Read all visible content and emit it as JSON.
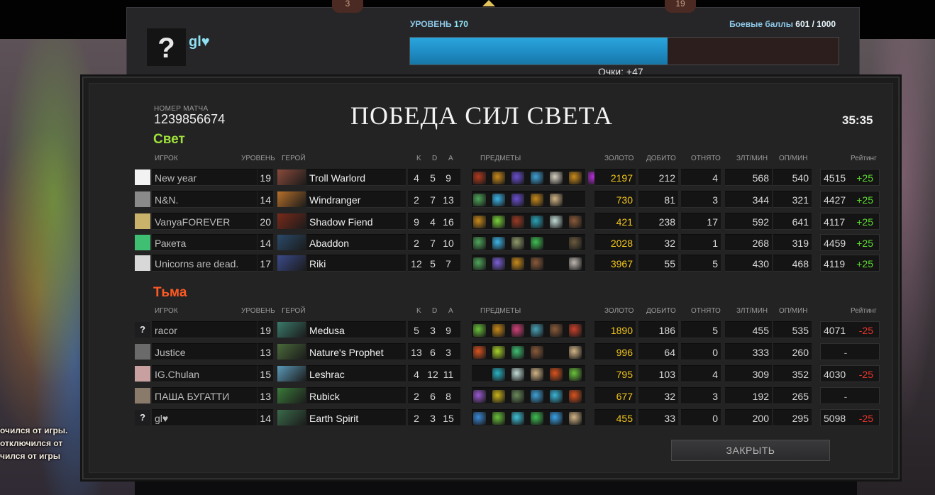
{
  "top_panel": {
    "badge_left": "3",
    "badge_right": "19",
    "avatar_glyph": "?",
    "player_name": "gl♥",
    "level_label": "УРОВЕНЬ",
    "level_value": "170",
    "battle_points_label": "Боевые баллы",
    "battle_points_value": "601 / 1000",
    "battle_points_fraction": 0.601,
    "points_gained": "Очки: +47"
  },
  "side_messages": [
    "очился от игры.",
    "отключился от",
    "чился от игры"
  ],
  "match": {
    "number_label": "НОМЕР МАТЧА",
    "number": "1239856674",
    "result_title": "ПОБЕДА СИЛ СВЕТА",
    "duration": "35:35"
  },
  "headers": {
    "player": "ИГРОК",
    "level": "УРОВЕНЬ",
    "hero": "ГЕРОЙ",
    "k": "K",
    "d": "D",
    "a": "A",
    "items": "ПРЕДМЕТЫ",
    "gold": "ЗОЛОТО",
    "last_hits": "ДОБИТО",
    "denies": "ОТНЯТО",
    "gpm": "ЗЛТ/МИН",
    "xpm": "ОП/МИН",
    "rating": "Рейтинг"
  },
  "teams": [
    {
      "name": "Свет",
      "players": [
        {
          "icon": "",
          "name": "New year",
          "level": "19",
          "hero": "Troll Warlord",
          "k": "4",
          "d": "5",
          "a": "9",
          "items": [
            "#b23a1f",
            "#c98a1a",
            "#6a4fd0",
            "#3fa2d8",
            "#d6d0c2",
            "#c98a1a",
            "#b52fd9"
          ],
          "gold": "2197",
          "last_hits": "212",
          "denies": "4",
          "gpm": "568",
          "xpm": "540",
          "rating": "4515",
          "delta": "+25"
        },
        {
          "icon": "",
          "name": "N&N.",
          "level": "14",
          "hero": "Windranger",
          "k": "2",
          "d": "7",
          "a": "13",
          "items": [
            "#4fa65a",
            "#3db5e8",
            "#6a4fd0",
            "#c98a1a",
            "#d2b486"
          ],
          "gold": "730",
          "last_hits": "81",
          "denies": "3",
          "gpm": "344",
          "xpm": "321",
          "rating": "4427",
          "delta": "+25"
        },
        {
          "icon": "",
          "name": "VanyaFOREVER",
          "level": "20",
          "hero": "Shadow Fiend",
          "k": "9",
          "d": "4",
          "a": "16",
          "items": [
            "#c98a1a",
            "#7bd23a",
            "#9a3a24",
            "#2aa3b8",
            "#c3dcd6",
            "#8a5a3a"
          ],
          "gold": "421",
          "last_hits": "238",
          "denies": "17",
          "gpm": "592",
          "xpm": "641",
          "rating": "4117",
          "delta": "+25"
        },
        {
          "icon": "",
          "name": "Ракета",
          "level": "14",
          "hero": "Abaddon",
          "k": "2",
          "d": "7",
          "a": "10",
          "items": [
            "#4fa65a",
            "#3db5e8",
            "#8e9a6a",
            "#3fbf52",
            "",
            "#6b5a3e"
          ],
          "gold": "2028",
          "last_hits": "32",
          "denies": "1",
          "gpm": "268",
          "xpm": "319",
          "rating": "4459",
          "delta": "+25"
        },
        {
          "icon": "",
          "name": "Unicorns are dead.",
          "level": "17",
          "hero": "Riki",
          "k": "12",
          "d": "5",
          "a": "7",
          "items": [
            "#4fa65a",
            "#7a5fd6",
            "#c98a1a",
            "#8a5a3a",
            "",
            "#bdb6b0"
          ],
          "gold": "3967",
          "last_hits": "55",
          "denies": "5",
          "gpm": "430",
          "xpm": "468",
          "rating": "4119",
          "delta": "+25"
        }
      ]
    },
    {
      "name": "Тьма",
      "players": [
        {
          "icon": "?",
          "name": "racor",
          "level": "19",
          "hero": "Medusa",
          "k": "5",
          "d": "3",
          "a": "9",
          "items": [
            "#6ac23a",
            "#c98a1a",
            "#d2417a",
            "#4aa2b8",
            "#8a5a3a",
            "#c9402a"
          ],
          "gold": "1890",
          "last_hits": "186",
          "denies": "5",
          "gpm": "455",
          "xpm": "535",
          "rating": "4071",
          "delta": "-25"
        },
        {
          "icon": "",
          "name": "Justice",
          "level": "13",
          "hero": "Nature's Prophet",
          "k": "13",
          "d": "6",
          "a": "3",
          "items": [
            "#d9531f",
            "#a8d22a",
            "#3fbf72",
            "#8a5a3a",
            "",
            "#d2b486"
          ],
          "gold": "996",
          "last_hits": "64",
          "denies": "0",
          "gpm": "333",
          "xpm": "260",
          "rating": "-",
          "delta": ""
        },
        {
          "icon": "",
          "name": "IG.Chulan",
          "level": "15",
          "hero": "Leshrac",
          "k": "4",
          "d": "12",
          "a": "11",
          "items": [
            "",
            "#2ab3c4",
            "#c3dcd6",
            "#d2b486",
            "#d9531f",
            "#6ac23a"
          ],
          "gold": "795",
          "last_hits": "103",
          "denies": "4",
          "gpm": "309",
          "xpm": "352",
          "rating": "4030",
          "delta": "-25"
        },
        {
          "icon": "",
          "name": "ПАША БУГАТТИ",
          "level": "13",
          "hero": "Rubick",
          "k": "2",
          "d": "6",
          "a": "8",
          "items": [
            "#9a5ad0",
            "#c9b21a",
            "#6a8a5a",
            "#3fa2d8",
            "#3ab6d8",
            "#d9531f"
          ],
          "gold": "677",
          "last_hits": "32",
          "denies": "3",
          "gpm": "192",
          "xpm": "265",
          "rating": "-",
          "delta": ""
        },
        {
          "icon": "?",
          "name": "gl♥",
          "level": "14",
          "hero": "Earth Spirit",
          "k": "2",
          "d": "3",
          "a": "15",
          "items": [
            "#3a8ad8",
            "#6ac23a",
            "#3fc2d8",
            "#3fbf52",
            "#3aa2e8",
            "#d2b486"
          ],
          "gold": "455",
          "last_hits": "33",
          "denies": "0",
          "gpm": "200",
          "xpm": "295",
          "rating": "5098",
          "delta": "-25"
        }
      ]
    }
  ],
  "close_label": "ЗАКРЫТЬ"
}
